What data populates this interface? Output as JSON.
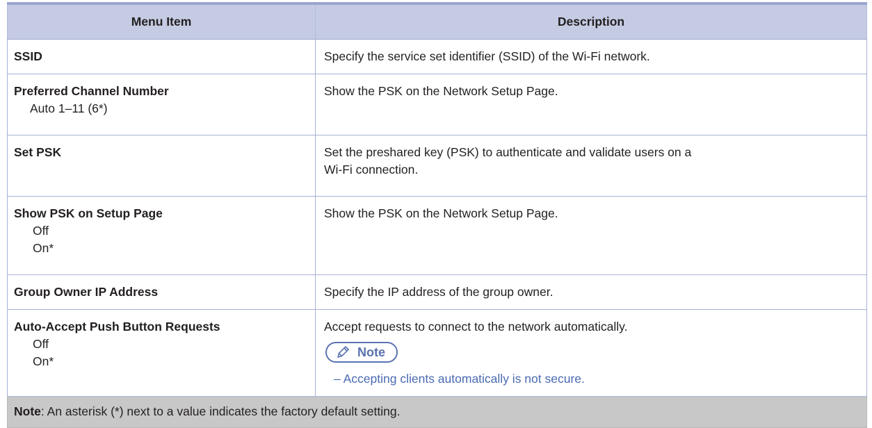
{
  "header": {
    "menu_item": "Menu Item",
    "description": "Description"
  },
  "rows": [
    {
      "label": "SSID",
      "options": [],
      "description": "Specify the service set identifier (SSID) of the Wi-Fi network."
    },
    {
      "label": "Preferred Channel Number",
      "options": [
        "Auto 1–11 (6*)"
      ],
      "description": "Show the PSK on the Network Setup Page."
    },
    {
      "label": "Set PSK",
      "options": [],
      "description_lines": [
        "Set the preshared key (PSK) to authenticate and validate users on a",
        "Wi-Fi connection."
      ]
    },
    {
      "label": "Show PSK on Setup Page",
      "options": [
        "Off",
        "On*"
      ],
      "description": "Show the PSK on the Network Setup Page."
    },
    {
      "label": "Group Owner IP Address",
      "options": [],
      "description": "Specify the IP address of the group owner."
    },
    {
      "label": "Auto-Accept Push Button Requests",
      "options": [
        "Off",
        "On*"
      ],
      "description": "Accept requests to connect to the network automatically.",
      "note": {
        "label": "Note",
        "icon": "pencil-icon",
        "bullet": "– Accepting clients automatically is not secure."
      }
    }
  ],
  "footer": {
    "note_label": "Note",
    "note_text": ": An asterisk (*) next to a value indicates the factory default setting."
  },
  "colors": {
    "header_bg": "#c5cbe3",
    "border": "#a7b1d6",
    "footer_bg": "#c8c8c8",
    "note_accent": "#5972b0"
  }
}
